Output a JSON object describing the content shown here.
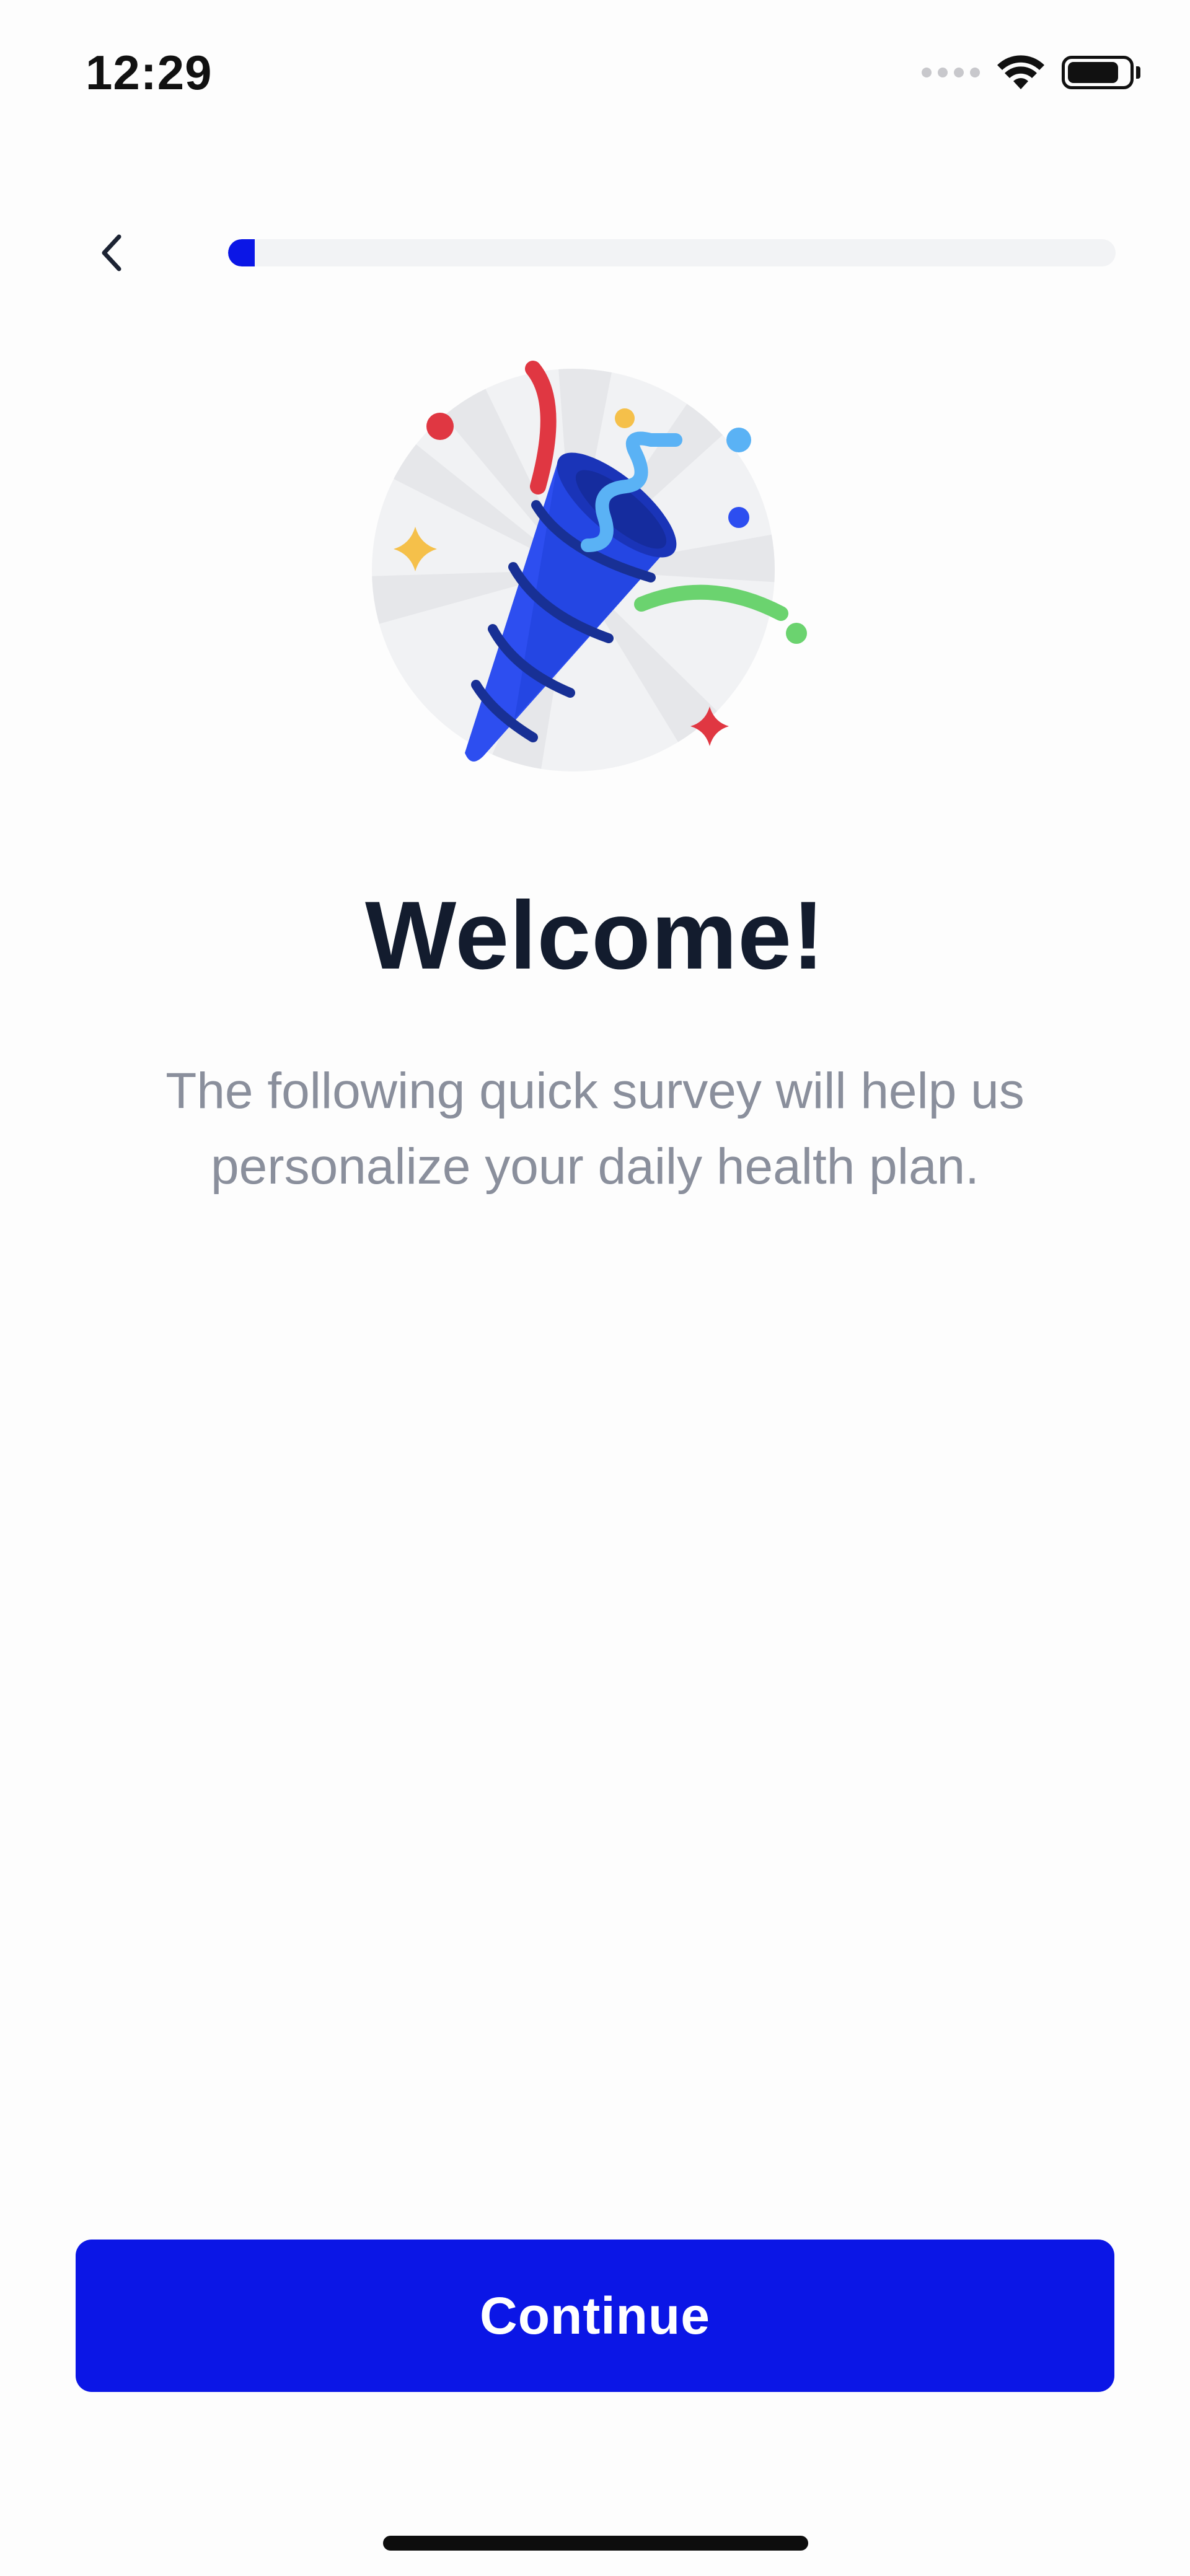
{
  "status_bar": {
    "time": "12:29"
  },
  "progress": {
    "fraction": 0.03
  },
  "colors": {
    "accent": "#0b16e6",
    "title": "#131c2e",
    "subtitle": "#8a8f9c",
    "track": "#f2f3f5"
  },
  "icons": {
    "back": "chevron-left-icon",
    "illustration": "party-popper-icon"
  },
  "welcome": {
    "title": "Welcome!",
    "subtitle": "The following quick survey will help us personalize your daily health plan."
  },
  "actions": {
    "continue_label": "Continue"
  }
}
